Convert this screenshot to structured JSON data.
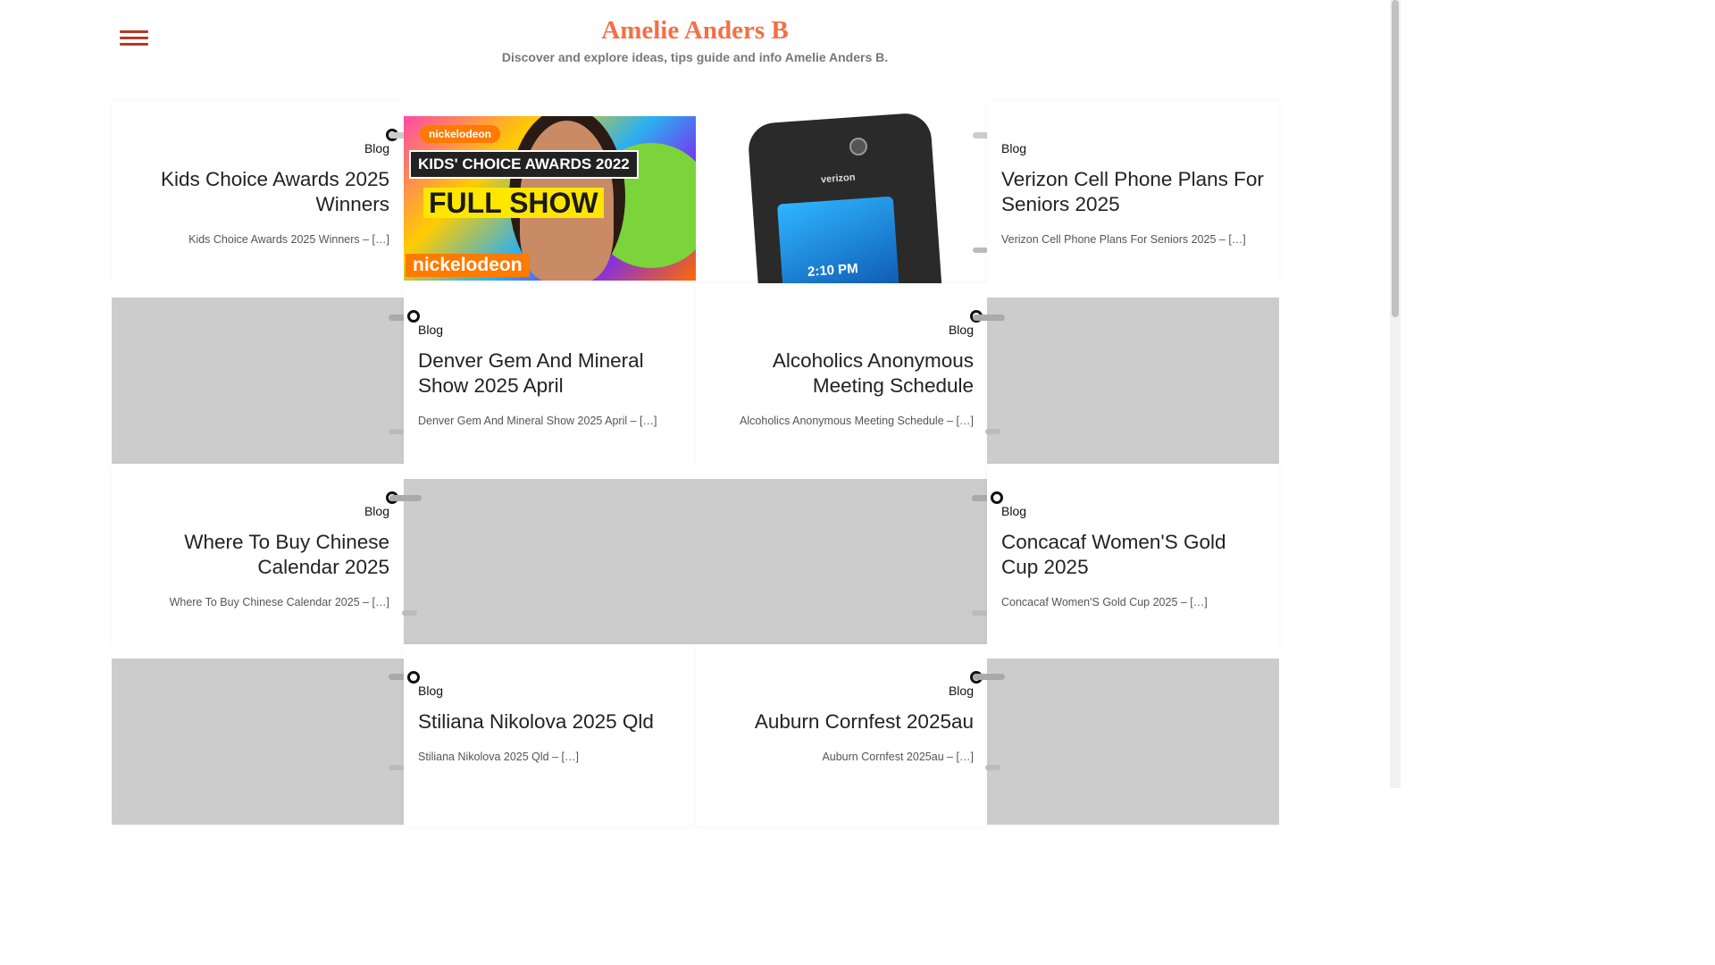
{
  "site": {
    "title": "Amelie Anders B",
    "description": "Discover and explore ideas, tips guide and info Amelie Anders B."
  },
  "thumbnails": {
    "kca": {
      "badge_top": "nickelodeon",
      "title_line": "KIDS' CHOICE AWARDS 2022",
      "big_text": "FULL SHOW",
      "badge_bottom": "nickelodeon"
    },
    "phone": {
      "brand": "verizon",
      "time": "2:10 PM"
    }
  },
  "posts": [
    {
      "category": "Blog",
      "title": "Kids Choice Awards 2025 Winners",
      "excerpt": "Kids Choice Awards 2025 Winners – […]"
    },
    {
      "category": "Blog",
      "title": "Verizon Cell Phone Plans For Seniors 2025",
      "excerpt": "Verizon Cell Phone Plans For Seniors 2025 – […]"
    },
    {
      "category": "Blog",
      "title": "Denver Gem And Mineral Show 2025 April",
      "excerpt": "Denver Gem And Mineral Show 2025 April – […]"
    },
    {
      "category": "Blog",
      "title": "Alcoholics Anonymous Meeting Schedule",
      "excerpt": "Alcoholics Anonymous Meeting Schedule – […]"
    },
    {
      "category": "Blog",
      "title": "Where To Buy Chinese Calendar 2025",
      "excerpt": "Where To Buy Chinese Calendar 2025 – […]"
    },
    {
      "category": "Blog",
      "title": "Concacaf Women'S Gold Cup 2025",
      "excerpt": "Concacaf Women'S Gold Cup 2025 – […]"
    },
    {
      "category": "Blog",
      "title": "Stiliana Nikolova 2025 Qld",
      "excerpt": "Stiliana Nikolova 2025 Qld – […]"
    },
    {
      "category": "Blog",
      "title": "Auburn Cornfest 2025au",
      "excerpt": "Auburn Cornfest 2025au – […]"
    }
  ]
}
